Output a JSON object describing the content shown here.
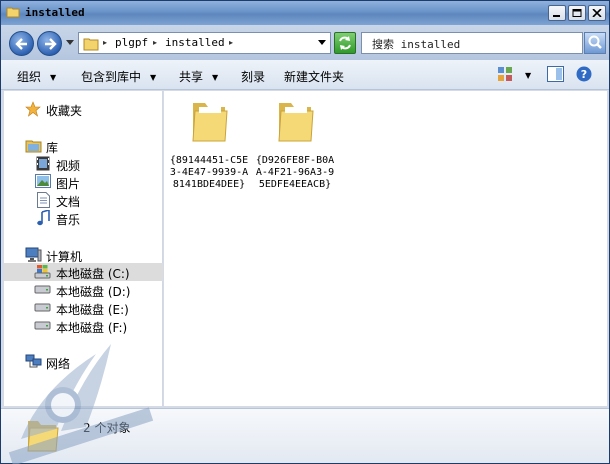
{
  "window": {
    "title": "installed"
  },
  "address": {
    "segments": [
      "plgpf",
      "installed"
    ]
  },
  "search": {
    "text": "搜索 installed"
  },
  "toolbar": {
    "organize": "组织",
    "include_in_library": "包含到库中",
    "share": "共享",
    "burn": "刻录",
    "new_folder": "新建文件夹"
  },
  "navpane": {
    "favorites": "收藏夹",
    "libraries": "库",
    "videos": "视频",
    "pictures": "图片",
    "documents": "文档",
    "music": "音乐",
    "computer": "计算机",
    "drives": [
      "本地磁盘 (C:)",
      "本地磁盘 (D:)",
      "本地磁盘 (E:)",
      "本地磁盘 (F:)"
    ],
    "network": "网络"
  },
  "files": [
    {
      "name": "{89144451-C5E3-4E47-9939-A8141BDE4DEE}"
    },
    {
      "name": "{D926FE8F-B0AA-4F21-96A3-95EDFE4EEACB}"
    }
  ],
  "status": {
    "count_text": "2 个对象"
  },
  "colors": {
    "selected_row": "#dcdcdc",
    "titlebar": "#6a93c8",
    "folder": "#f3d36b"
  }
}
